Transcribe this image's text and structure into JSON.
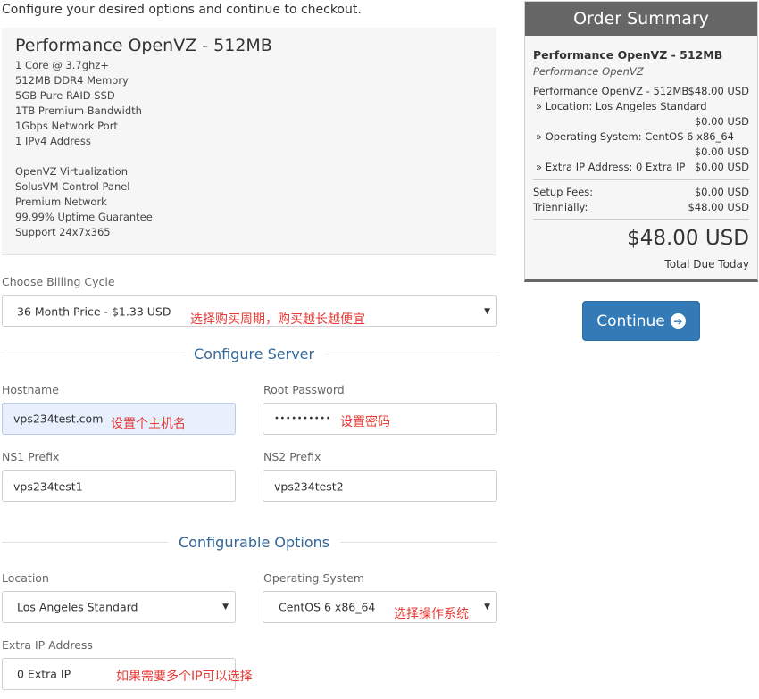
{
  "intro": "Configure your desired options and continue to checkout.",
  "product": {
    "title": "Performance OpenVZ - 512MB",
    "features": [
      "1 Core @ 3.7ghz+",
      "512MB DDR4 Memory",
      "5GB Pure RAID SSD",
      "1TB Premium Bandwidth",
      "1Gbps Network Port",
      "1 IPv4 Address",
      "OpenVZ Virtualization",
      "SolusVM Control Panel",
      "Premium Network",
      "99.99% Uptime Guarantee",
      "Support 24x7x365"
    ]
  },
  "billing": {
    "label": "Choose Billing Cycle",
    "value": "36 Month Price - $1.33 USD",
    "note": "选择购买周期，购买越长越便宜"
  },
  "configure_server": {
    "heading": "Configure Server",
    "hostname": {
      "label": "Hostname",
      "value": "vps234test.com",
      "note": "设置个主机名"
    },
    "root_password": {
      "label": "Root Password",
      "value": "••••••••••",
      "note": "设置密码"
    },
    "ns1": {
      "label": "NS1 Prefix",
      "value": "vps234test1"
    },
    "ns2": {
      "label": "NS2 Prefix",
      "value": "vps234test2"
    }
  },
  "configurable_options": {
    "heading": "Configurable Options",
    "location": {
      "label": "Location",
      "value": "Los Angeles Standard"
    },
    "os": {
      "label": "Operating System",
      "value": "CentOS 6 x86_64",
      "note": "选择操作系统"
    },
    "extra_ip": {
      "label": "Extra IP Address",
      "value": "0 Extra IP",
      "note": "如果需要多个IP可以选择"
    }
  },
  "summary": {
    "heading": "Order Summary",
    "product_name": "Performance OpenVZ - 512MB",
    "product_group": "Performance OpenVZ",
    "line_item": {
      "label": "Performance OpenVZ - 512MB",
      "price": "$48.00 USD"
    },
    "location": {
      "label": "» Location: Los Angeles Standard",
      "price": "$0.00 USD"
    },
    "os": {
      "label": "» Operating System: CentOS 6 x86_64",
      "price": "$0.00 USD"
    },
    "extra_ip": {
      "label": "» Extra IP Address: 0 Extra IP",
      "price": "$0.00 USD"
    },
    "setup_fees": {
      "label": "Setup Fees:",
      "price": "$0.00 USD"
    },
    "cycle": {
      "label": "Triennially:",
      "price": "$48.00 USD"
    },
    "total": "$48.00 USD",
    "total_label": "Total Due Today"
  },
  "continue_button": {
    "label": "Continue",
    "icon": "arrow-circle-right-icon"
  }
}
